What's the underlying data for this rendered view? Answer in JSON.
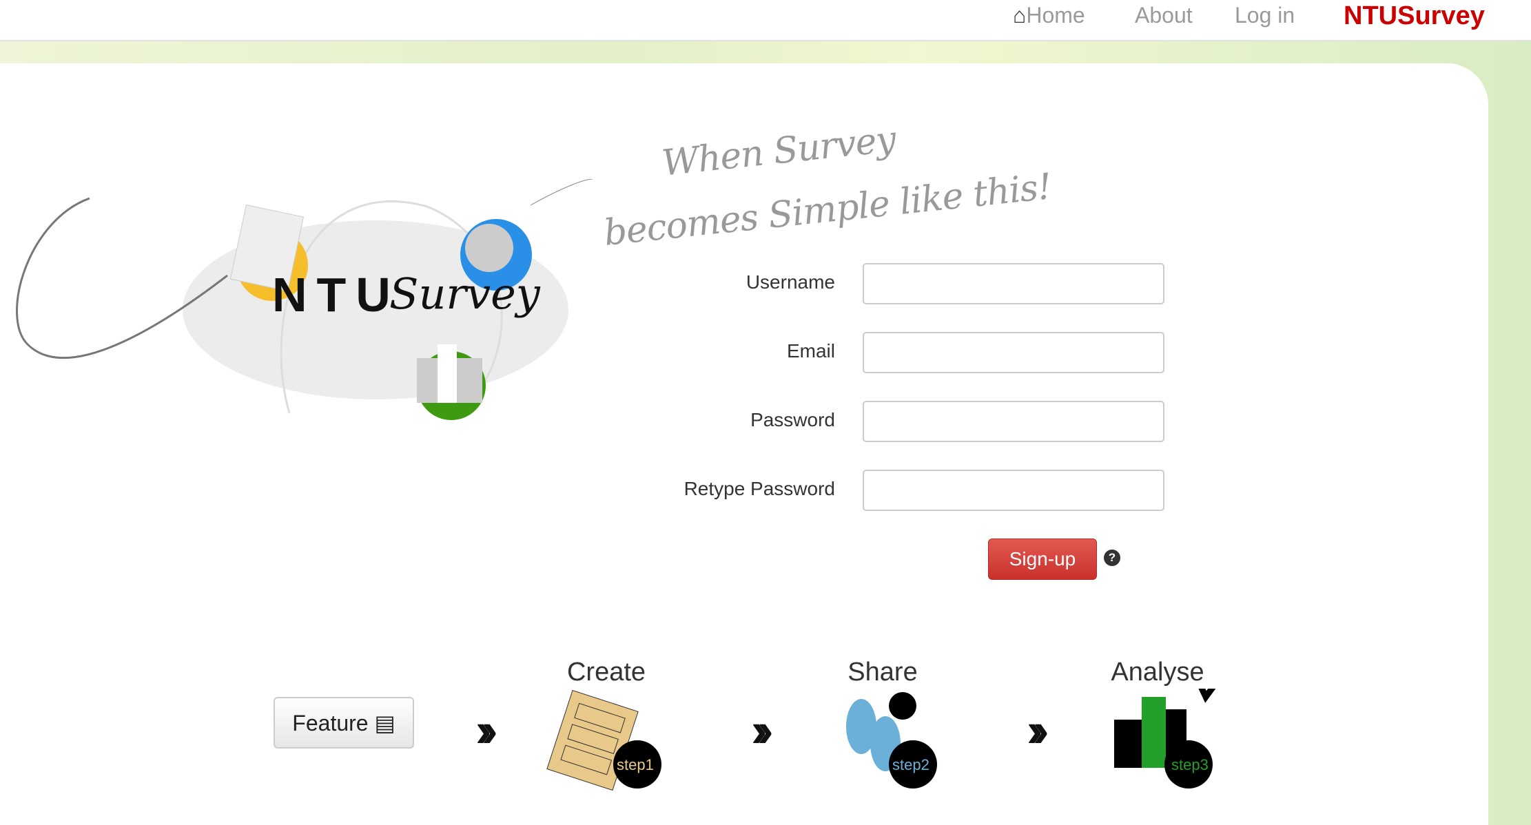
{
  "nav": {
    "home": "Home",
    "about": "About",
    "login": "Log in",
    "brand": "NTUSurvey"
  },
  "logo": {
    "text": "NTU",
    "script": "Survey"
  },
  "tagline": {
    "line1": "When Survey",
    "line2": "becomes Simple like this!"
  },
  "form": {
    "fields": [
      {
        "label": "Username",
        "value": ""
      },
      {
        "label": "Email",
        "value": ""
      },
      {
        "label": "Password",
        "value": ""
      },
      {
        "label": "Retype Password",
        "value": ""
      }
    ],
    "submit": "Sign-up",
    "help": "?"
  },
  "steps": {
    "feature": "Feature",
    "items": [
      {
        "title": "Create",
        "badge": "step1",
        "color": "#e8c98a"
      },
      {
        "title": "Share",
        "badge": "step2",
        "color": "#6ab0d8"
      },
      {
        "title": "Analyse",
        "badge": "step3",
        "color": "#22a02a"
      }
    ]
  },
  "colors": {
    "brand": "#cc0000",
    "button": "#d9403a"
  }
}
